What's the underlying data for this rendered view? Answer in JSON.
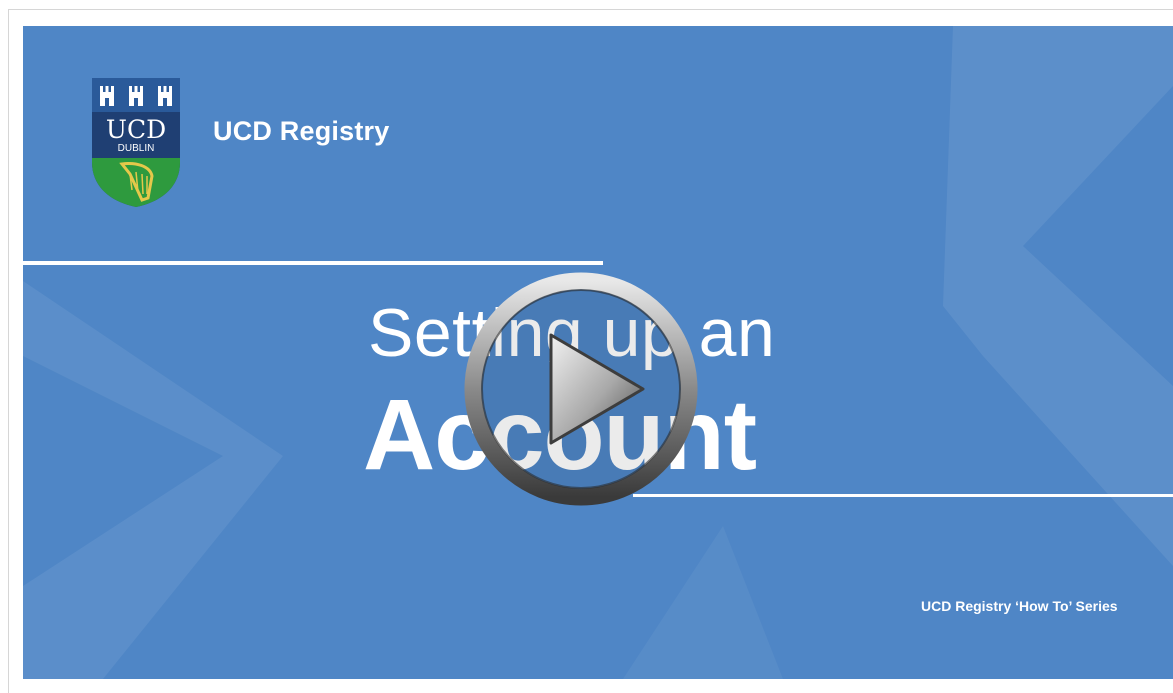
{
  "video": {
    "brand": "UCD Registry",
    "title_line1": "Setting up an",
    "title_line2": "Account",
    "series": "UCD Registry ‘How To’ Series",
    "logo": {
      "line1": "UCD",
      "line2": "DUBLIN",
      "icon": "ucd-crest-icon"
    },
    "play_icon": "play-icon"
  },
  "colors": {
    "background": "#4f86c6",
    "text": "#ffffff",
    "crest_blue": "#1f3f73",
    "crest_green": "#2e9a3e",
    "crest_gold": "#e5c84a"
  }
}
